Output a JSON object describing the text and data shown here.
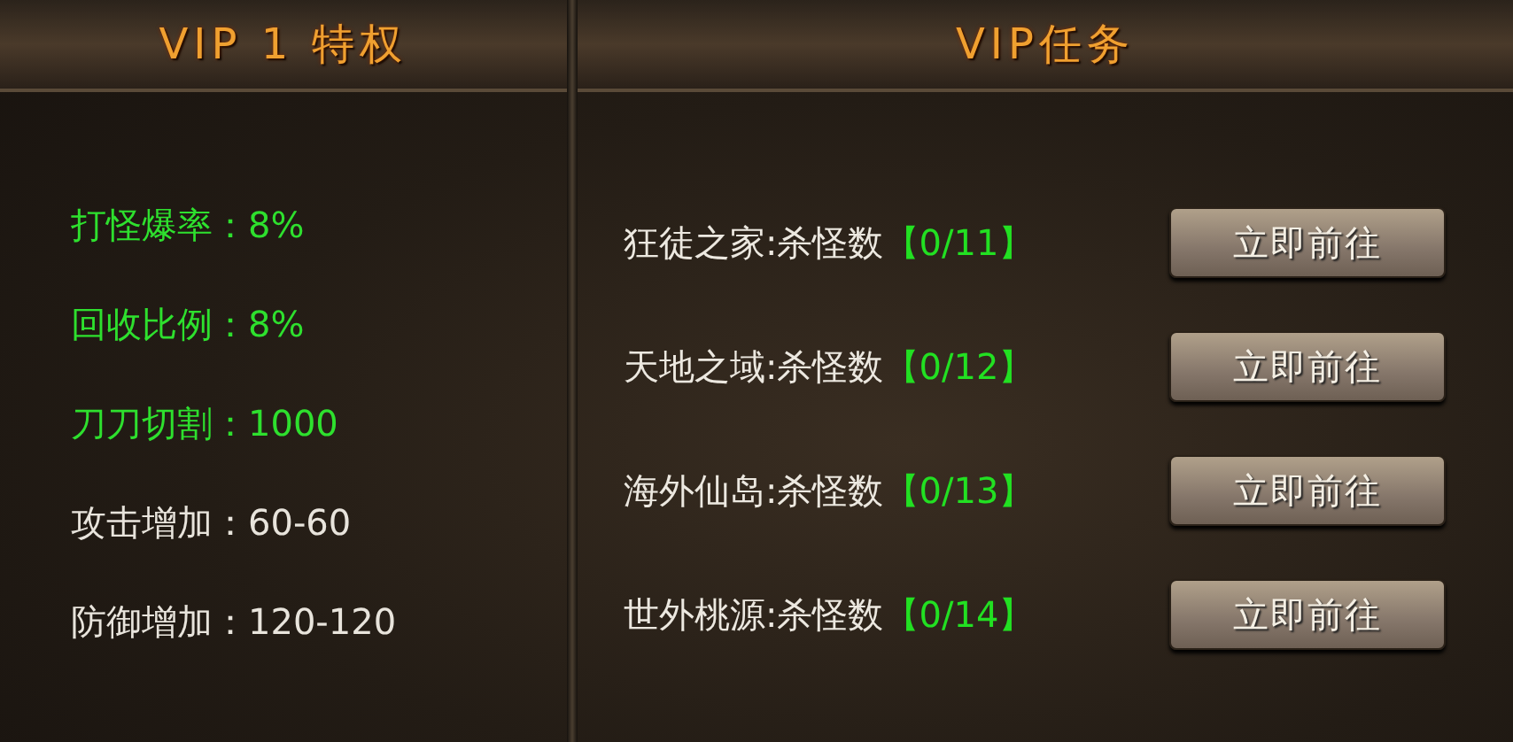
{
  "privileges_panel": {
    "title": "VIP 1 特权",
    "items": [
      {
        "text": "打怪爆率：8%",
        "color": "#2ee02e"
      },
      {
        "text": "回收比例：8%",
        "color": "#2ee02e"
      },
      {
        "text": "刀刀切割：1000",
        "color": "#2ee02e"
      },
      {
        "text": "攻击增加：60-60",
        "color": "#e8e4dc"
      },
      {
        "text": "防御增加：120-120",
        "color": "#e8e4dc"
      }
    ]
  },
  "tasks_panel": {
    "title": "VIP任务",
    "tasks": [
      {
        "name": "狂徒之家:杀怪数",
        "progress": "【0/11】",
        "button": "立即前往"
      },
      {
        "name": "天地之域:杀怪数",
        "progress": "【0/12】",
        "button": "立即前往"
      },
      {
        "name": "海外仙岛:杀怪数",
        "progress": "【0/13】",
        "button": "立即前往"
      },
      {
        "name": "世外桃源:杀怪数",
        "progress": "【0/14】",
        "button": "立即前往"
      }
    ]
  }
}
